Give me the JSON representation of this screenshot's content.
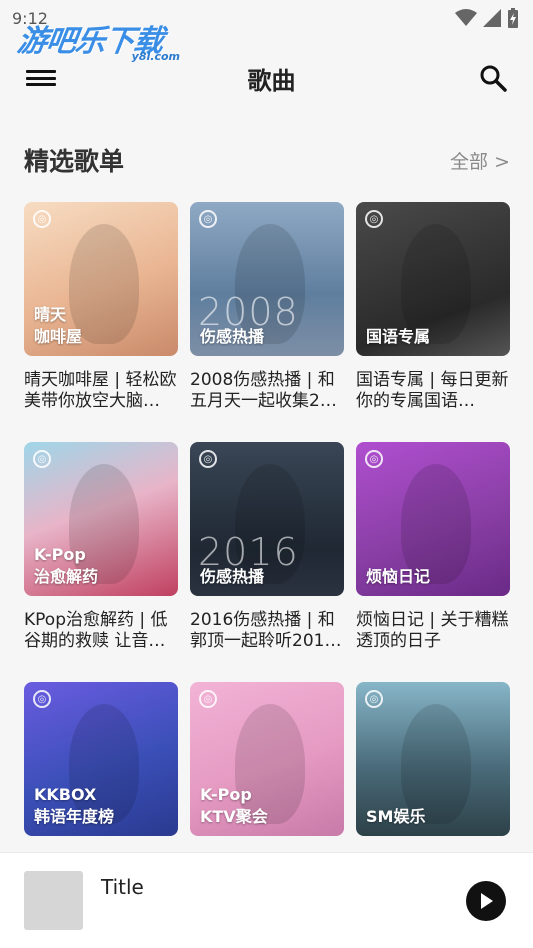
{
  "status": {
    "time": "9:12"
  },
  "watermark": {
    "main": "游吧乐下载",
    "sub": "y8l.com"
  },
  "app_bar": {
    "title": "歌曲"
  },
  "section": {
    "title": "精选歌单",
    "more": "全部 >"
  },
  "playlists": [
    {
      "cover_text": "晴天\n咖啡屋",
      "year": "",
      "desc": "晴天咖啡屋 | 轻松欧美带你放空大脑…",
      "bg": "#f0c9a8"
    },
    {
      "cover_text": "伤感热播",
      "year": "2008",
      "desc": "2008伤感热播 | 和五月天一起收集2…",
      "bg": "#6f8fb0"
    },
    {
      "cover_text": "国语专属",
      "year": "",
      "desc": "国语专属 | 每日更新 你的专属国语…",
      "bg": "#3a3a3a"
    },
    {
      "cover_text": "K-Pop\n治愈解药",
      "year": "",
      "desc": "KPop治愈解药 | 低谷期的救赎 让音…",
      "bg": "#c98ea8"
    },
    {
      "cover_text": "伤感热播",
      "year": "2016",
      "desc": "2016伤感热播 | 和郭顶一起聆听201…",
      "bg": "#2f3a4a"
    },
    {
      "cover_text": "烦恼日记",
      "year": "",
      "desc": "烦恼日记 | 关于糟糕透顶的日子",
      "bg": "#8a3fa6"
    },
    {
      "cover_text": "KKBOX\n韩语年度榜",
      "year": "",
      "desc": "",
      "bg": "#3b4fb8"
    },
    {
      "cover_text": "K-Pop\nKTV聚会",
      "year": "",
      "desc": "",
      "bg": "#e59ac2"
    },
    {
      "cover_text": "SM娱乐",
      "year": "",
      "desc": "",
      "bg": "#4a6b7a"
    }
  ],
  "player": {
    "title": "Title"
  }
}
